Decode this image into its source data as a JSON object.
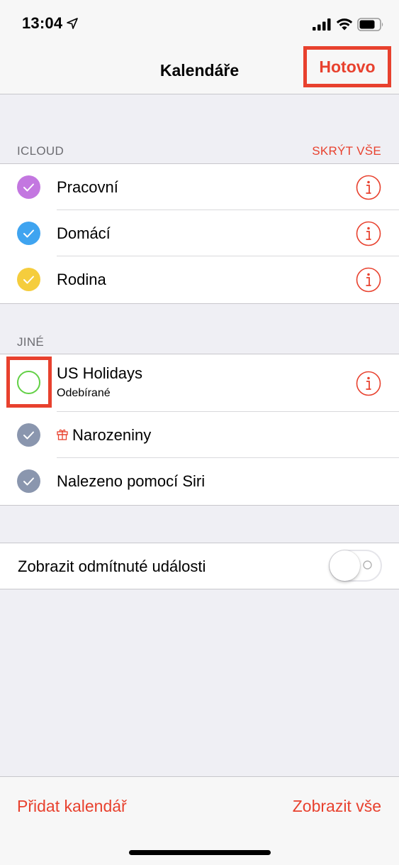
{
  "status_bar": {
    "time": "13:04",
    "icons": [
      "location-arrow-icon",
      "cellular-signal-icon",
      "wifi-icon",
      "battery-icon"
    ]
  },
  "nav": {
    "title": "Kalendáře",
    "done_label": "Hotovo"
  },
  "colors": {
    "accent": "#e8412e",
    "purple": "#c377e0",
    "blue": "#3fa4f0",
    "yellow": "#f5cd3d",
    "gray_slate": "#8a96ae",
    "green_outline": "#62d045"
  },
  "sections": {
    "icloud": {
      "header": "ICLOUD",
      "action": "SKRÝT VŠE",
      "items": [
        {
          "label": "Pracovní",
          "color": "#c377e0",
          "checked": true
        },
        {
          "label": "Domácí",
          "color": "#3fa4f0",
          "checked": true
        },
        {
          "label": "Rodina",
          "color": "#f5cd3d",
          "checked": true
        }
      ]
    },
    "other": {
      "header": "JINÉ",
      "items": [
        {
          "label": "US Holidays",
          "sublabel": "Odebírané",
          "color": "#62d045",
          "checked": false
        },
        {
          "label": "Narozeniny",
          "color": "#8a96ae",
          "checked": true,
          "icon": "gift-icon"
        },
        {
          "label": "Nalezeno pomocí Siri",
          "color": "#8a96ae",
          "checked": true
        }
      ]
    }
  },
  "settings": {
    "declined_label": "Zobrazit odmítnuté události",
    "declined_enabled": false
  },
  "toolbar": {
    "add_label": "Přidat kalendář",
    "show_all_label": "Zobrazit vše"
  }
}
